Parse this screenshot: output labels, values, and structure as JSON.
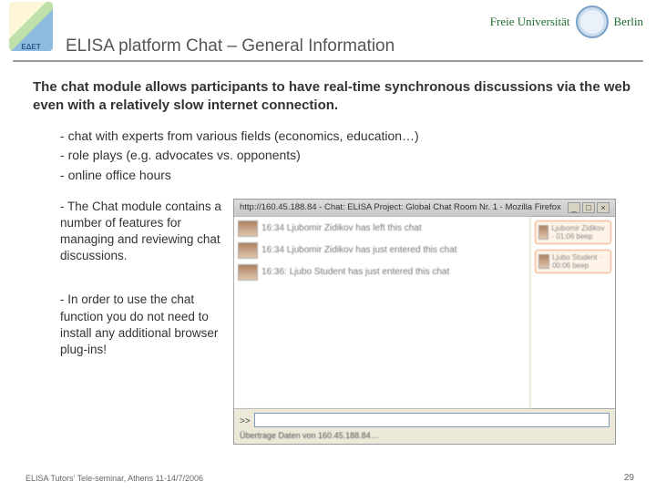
{
  "header": {
    "grnet_label": "ΕΔΕΤ",
    "fub_label": "Freie Universität",
    "fub_city": "Berlin",
    "title": "ELISA platform Chat – General Information"
  },
  "intro": "The chat module allows participants to have real-time synchronous discussions via the web even with a relatively slow internet connection.",
  "bullets_top": [
    "chat with experts from various fields (economics, education…)",
    "role plays (e.g. advocates vs. opponents)",
    "online office hours"
  ],
  "bullets_side": [
    "The Chat module contains a number of features for managing and reviewing chat discussions.",
    "In order to use the chat function you do not need to install any additional browser plug-ins!"
  ],
  "chat": {
    "window_title": "http://160.45.188.84 - Chat: ELISA Project: Global Chat Room Nr. 1 - Mozilla Firefox",
    "messages": [
      "16:34 Ljubomir Zidikov has left this chat",
      "16:34 Ljubomir Zidikov has just entered this chat",
      "16:36: Ljubo Student has just entered this chat"
    ],
    "users": [
      "Ljubomir Zidikov · 01:06 beep",
      "Ljubo Student · 00:06 beep"
    ],
    "prompt": ">>",
    "status": "Übertrage Daten von 160.45.188.84…"
  },
  "footer": "ELISA Tutors' Tele-seminar, Athens 11-14/7/2006",
  "page_number": "29"
}
